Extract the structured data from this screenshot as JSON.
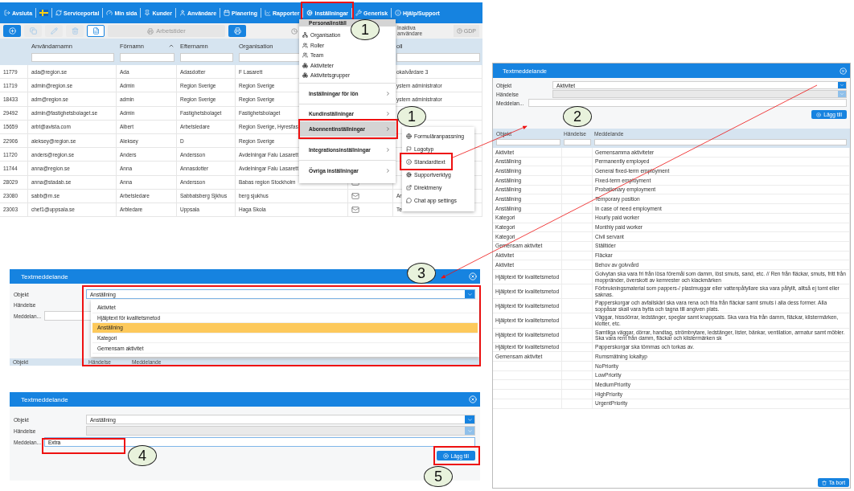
{
  "user_list": {
    "nav": [
      {
        "kind": "exit",
        "label": "Avsluta"
      },
      {
        "kind": "flag"
      },
      {
        "kind": "portal",
        "label": "Serviceportal"
      },
      {
        "kind": "dashboard",
        "label": "Min sida"
      },
      {
        "kind": "pin",
        "label": "Kunder"
      },
      {
        "kind": "user",
        "label": "Användare"
      },
      {
        "kind": "calendar",
        "label": "Planering"
      },
      {
        "kind": "chart",
        "label": "Rapporter"
      },
      {
        "kind": "cogs",
        "label": "Inställningar"
      },
      {
        "kind": "wrench",
        "label": "Generisk"
      },
      {
        "kind": "info",
        "label": "Hjälp/Support"
      }
    ],
    "toolbar": {
      "buttons": [
        {
          "kind": "add",
          "disabled": false
        },
        {
          "kind": "copy",
          "disabled": true
        },
        {
          "kind": "edit",
          "disabled": true
        },
        {
          "kind": "delete",
          "disabled": true
        },
        {
          "kind": "excel",
          "disabled": false
        }
      ],
      "work_hours": {
        "label": "Arbetstider",
        "disabled": true
      },
      "inactive_label": "Inaktiva användare",
      "gdpr": "GDP"
    },
    "columns": [
      {},
      {
        "label": "Användarnamn"
      },
      {
        "label": "Förnamn",
        "sorted": true
      },
      {
        "label": "Efternamn"
      },
      {
        "label": "Organisation"
      },
      {},
      {
        "label": "oll"
      }
    ],
    "rows": [
      {
        "cells": [
          "11779",
          "ada@region.se",
          "Ada",
          "Adasdotter",
          "F Lasarett",
          "okalvårdare 3"
        ]
      },
      {
        "cells": [
          "11719",
          "admin@region.se",
          "Admin",
          "Region Sverige",
          "Region Sverige",
          "ystem administrator"
        ]
      },
      {
        "cells": [
          "18433",
          "adm@region.se",
          "admin",
          "Region Sverige",
          "Region Sverige",
          "ystem administrator"
        ]
      },
      {
        "cells": [
          "29492",
          "admin@fastighetsbolaget.se",
          "Admin",
          "Fastighetsbolaget",
          "Fastighetsbolaget",
          ""
        ]
      },
      {
        "cells": [
          "15659",
          "arbt@avista.com",
          "Albert",
          "Arbetsledare",
          "Region Sverige, Hyresfas",
          ""
        ]
      },
      {
        "cells": [
          "22906",
          "aleksey@region.se",
          "Aleksey",
          "D",
          "Region Sverige",
          ""
        ]
      },
      {
        "cells": [
          "11720",
          "anders@region.se",
          "Anders",
          "Andersson",
          "Avdelningar Falu Lasarett",
          ""
        ]
      },
      {
        "cells": [
          "11744",
          "anna@region.se",
          "Anna",
          "Annasdotter",
          "Avdelningar Falu Lasarett",
          ""
        ]
      },
      {
        "cells": [
          "28029",
          "anna@stadab.se",
          "Anna",
          "Andersson",
          "Babas region Stockholm",
          ""
        ],
        "mail": true
      },
      {
        "cells": [
          "23080",
          "sabb@rn.se",
          "Arbetsledare",
          "Sabbatsberg Sjkhus",
          "berg sjukhus",
          "Ar"
        ],
        "mail": true
      },
      {
        "cells": [
          "23003",
          "chef1@uppsala.se",
          "Arbledare",
          "Uppsala",
          "Haga Skola",
          "Te"
        ],
        "mail": true
      }
    ],
    "settings_menu": [
      {
        "kind": "header",
        "label": "Personalinställ",
        "selected": true
      },
      {
        "kind": "icon",
        "label": "Organisation",
        "selected": false
      },
      {
        "kind": "icon",
        "label": "Roller",
        "selected": false
      },
      {
        "kind": "icon",
        "label": "Team",
        "selected": false
      },
      {
        "kind": "icon",
        "label": "Aktiviteter",
        "selected": false
      },
      {
        "kind": "icon",
        "label": "Aktivitetsgrupper",
        "selected": false
      },
      {
        "kind": "group",
        "label": "Inställningar för lön",
        "selected": false
      },
      {
        "kind": "group",
        "label": "Kundinställningar",
        "selected": false
      },
      {
        "kind": "group",
        "label": "Abonnentinställningar",
        "selected": true
      },
      {
        "kind": "group",
        "label": "Integrationsinställningar",
        "selected": false
      },
      {
        "kind": "group",
        "label": "Övriga inställningar",
        "selected": false
      }
    ],
    "submenu": [
      {
        "label": "Formuläranpassning"
      },
      {
        "label": "Logotyp"
      },
      {
        "label": "Standardtext"
      },
      {
        "label": "Supportverktyg"
      },
      {
        "label": "Direktmeny"
      },
      {
        "label": "Chat app settings"
      }
    ]
  },
  "detail_panel": {
    "title": "Textmeddelande",
    "objekt_label": "Objekt",
    "objekt_value": "Aktivitet",
    "handelse_label": "Händelse",
    "meddelande_label": "Meddelan...",
    "add_button": "Lägg till",
    "columns": [
      "Objekt",
      "Händelse",
      "Meddelande"
    ],
    "rows": [
      [
        "Aktivitet",
        "",
        "Gemensamma aktiviteter"
      ],
      [
        "Anställning",
        "",
        "Permanently employed"
      ],
      [
        "Anställning",
        "",
        "General fixed-term employment"
      ],
      [
        "Anställning",
        "",
        "Fixed-term employment"
      ],
      [
        "Anställning",
        "",
        "Probationary employment"
      ],
      [
        "Anställning",
        "",
        "Temporary position"
      ],
      [
        "Anställning",
        "",
        "In case of need employment"
      ],
      [
        "Kategori",
        "",
        "Hourly paid worker"
      ],
      [
        "Kategori",
        "",
        "Monthly paid worker"
      ],
      [
        "Kategori",
        "",
        "Civil servant"
      ],
      [
        "Gemensam aktivitet",
        "",
        "Ställtider"
      ],
      [
        "Aktivitet",
        "",
        "Fläckar"
      ],
      [
        "Aktivitet",
        "",
        "Behov av golvvård"
      ],
      [
        "Hjälptext för kvalitetsmetod",
        "",
        "Golvytan ska vara fri från lösa föremål som damm, löst smuts, sand, etc. // Ren från fläckar, smuts, fritt från moppränder, överskott av kemrester och klackmärken"
      ],
      [
        "Hjälptext för kvalitetsmetod",
        "",
        "Förbrukningsmaterial som pappers-/ plastmuggar eller vattenpåfyllare ska vara påfyllt, alltså ej tomt eller saknas."
      ],
      [
        "Hjälptext för kvalitetsmetod",
        "",
        "Papperskorgar och avfallskärl ska vara rena och fria från fläckar samt smuts i alla dess former. Alla soppåsar skall vara bytta och tagna till angiven plats."
      ],
      [
        "Hjälptext för kvalitetsmetod",
        "",
        "Väggar, hissdörrar, ledstänger, speglar samt knappsats. Ska vara fria från damm, fläckar, klistermärken, klotter, etc."
      ],
      [
        "Hjälptext för kvalitetsmetod",
        "",
        "Samtliga väggar, dörrar, handtag, strömbrytare, ledstänger, lister, bänkar, ventilation, armatur samt möbler. Ska vara rent från damm, fläckar och klistermärken sk"
      ],
      [
        "Hjälptext för kvalitetsmetod",
        "",
        "Papperskorgar ska tömmas och torkas av."
      ],
      [
        "Gemensam aktivitet",
        "",
        "Rumsmätning lokaltyp"
      ],
      [
        "",
        "",
        "NoPriority"
      ],
      [
        "",
        "",
        "LowPriority"
      ],
      [
        "",
        "",
        "MediumPriority"
      ],
      [
        "",
        "",
        "HighPriority"
      ],
      [
        "",
        "",
        "UrgentPriority"
      ]
    ],
    "delete_button": "Ta bort"
  },
  "dropdown_panel": {
    "title": "Textmeddelande",
    "objekt_label": "Objekt",
    "objekt_value": "Anställning",
    "open": true,
    "options": [
      {
        "label": "Aktivitet",
        "selected": false
      },
      {
        "label": "Hjälptext för kvalitetsmetod",
        "selected": false
      },
      {
        "label": "Anställning",
        "selected": true
      },
      {
        "label": "Kategori",
        "selected": false
      },
      {
        "label": "Gemensam aktivitet",
        "selected": false
      }
    ],
    "handelse_label": "Händelse",
    "meddelande_label": "Meddelan...",
    "columns": [
      "Objekt",
      "Händelse",
      "Meddelande"
    ]
  },
  "add_panel": {
    "title": "Textmeddelande",
    "objekt_label": "Objekt",
    "objekt_value": "Anställning",
    "handelse_label": "Händelse",
    "meddelande_label": "Meddelan...",
    "meddelande_value": "Extra",
    "add_button": "Lägg till"
  },
  "steps": [
    {
      "label": "1"
    },
    {
      "label": "1"
    },
    {
      "label": "2"
    },
    {
      "label": "3"
    },
    {
      "label": "4"
    },
    {
      "label": "5"
    }
  ]
}
